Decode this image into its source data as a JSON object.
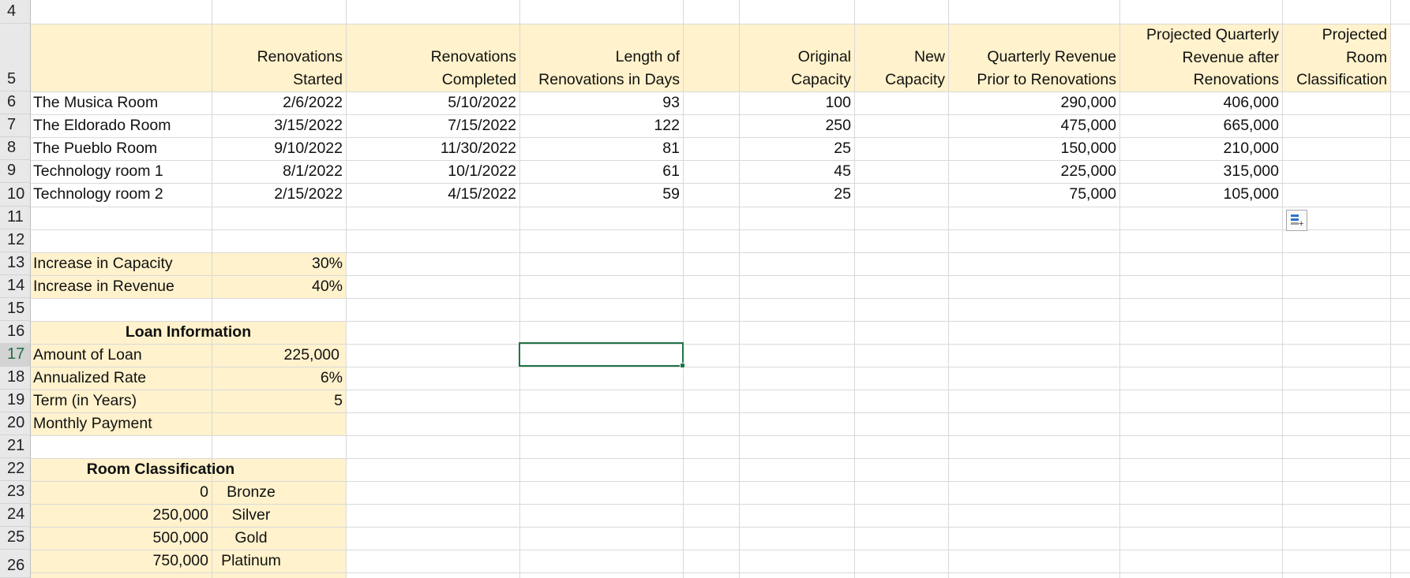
{
  "row_numbers": [
    "4",
    "5",
    "6",
    "7",
    "8",
    "9",
    "10",
    "11",
    "12",
    "13",
    "14",
    "15",
    "16",
    "17",
    "18",
    "19",
    "20",
    "21",
    "22",
    "23",
    "24",
    "25",
    "26"
  ],
  "active_row": "17",
  "headers": {
    "renovations_started": [
      "Renovations",
      "Started"
    ],
    "renovations_completed": [
      "Renovations",
      "Completed"
    ],
    "length_days": [
      "Length of",
      "Renovations in Days"
    ],
    "original_capacity": [
      "Original",
      "Capacity"
    ],
    "new_capacity": [
      "New",
      "Capacity"
    ],
    "quarterly_revenue_prior": [
      "Quarterly Revenue",
      "Prior to Renovations"
    ],
    "projected_quarterly_revenue": [
      "Projected Quarterly",
      "Revenue after",
      "Renovations"
    ],
    "projected_room_classification": [
      "Projected",
      "Room",
      "Classification"
    ]
  },
  "rooms": [
    {
      "name": "The Musica Room",
      "started": "2/6/2022",
      "completed": "5/10/2022",
      "days": "93",
      "orig_cap": "100",
      "rev_prior": "290,000",
      "rev_proj": "406,000"
    },
    {
      "name": "The Eldorado Room",
      "started": "3/15/2022",
      "completed": "7/15/2022",
      "days": "122",
      "orig_cap": "250",
      "rev_prior": "475,000",
      "rev_proj": "665,000"
    },
    {
      "name": "The Pueblo Room",
      "started": "9/10/2022",
      "completed": "11/30/2022",
      "days": "81",
      "orig_cap": "25",
      "rev_prior": "150,000",
      "rev_proj": "210,000"
    },
    {
      "name": "Technology room 1",
      "started": "8/1/2022",
      "completed": "10/1/2022",
      "days": "61",
      "orig_cap": "45",
      "rev_prior": "225,000",
      "rev_proj": "315,000"
    },
    {
      "name": "Technology room 2",
      "started": "2/15/2022",
      "completed": "4/15/2022",
      "days": "59",
      "orig_cap": "25",
      "rev_prior": "75,000",
      "rev_proj": "105,000"
    }
  ],
  "increase": {
    "capacity_label": "Increase in Capacity",
    "capacity_value": "30%",
    "revenue_label": "Increase in Revenue",
    "revenue_value": "40%"
  },
  "loan": {
    "title": "Loan Information",
    "amount_label": "Amount of Loan",
    "amount_value": "225,000",
    "rate_label": "Annualized Rate",
    "rate_value": "6%",
    "term_label": "Term (in Years)",
    "term_value": "5",
    "payment_label": "Monthly Payment"
  },
  "classification": {
    "title": "Room Classification",
    "rows": [
      {
        "threshold": "0",
        "level": "Bronze"
      },
      {
        "threshold": "250,000",
        "level": "Silver"
      },
      {
        "threshold": "500,000",
        "level": "Gold"
      },
      {
        "threshold": "750,000",
        "level": "Platinum"
      }
    ]
  },
  "colors": {
    "fill": "#fff2cc",
    "grid": "#d9d9d9",
    "selection": "#217346"
  },
  "icons": {
    "quick_analysis": "quick-analysis-icon"
  }
}
